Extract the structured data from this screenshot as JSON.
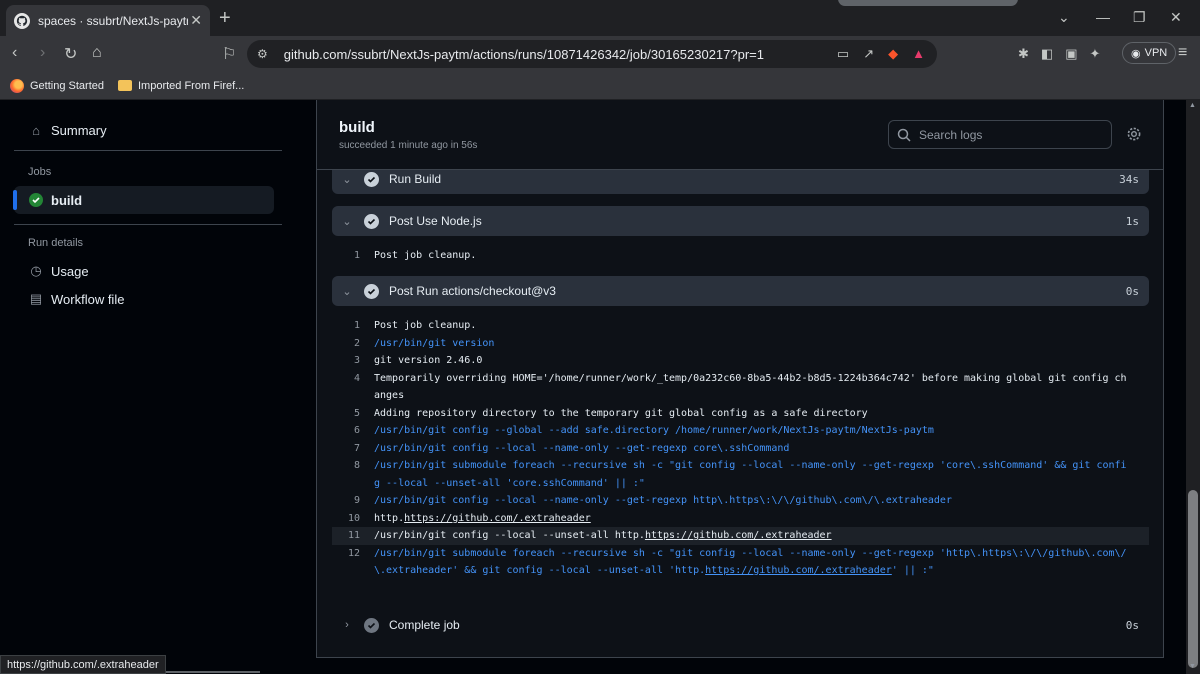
{
  "browser": {
    "tab_title": "spaces · ssubrt/NextJs-paytm@",
    "url": "github.com/ssubrt/NextJs-paytm/actions/runs/10871426342/job/30165230217?pr=1",
    "vpn_label": "VPN",
    "bookmarks": [
      "Getting Started",
      "Imported From Firef..."
    ],
    "status_url": "https://github.com/.extraheader"
  },
  "sidebar": {
    "summary": "Summary",
    "jobs_heading": "Jobs",
    "job": "build",
    "run_details_heading": "Run details",
    "usage": "Usage",
    "workflow_file": "Workflow file"
  },
  "job": {
    "title": "build",
    "subtitle": "succeeded 1 minute ago in 56s",
    "search_placeholder": "Search logs"
  },
  "steps": [
    {
      "name": "Run Build",
      "duration": "34s"
    },
    {
      "name": "Post Use Node.js",
      "duration": "1s"
    },
    {
      "name": "Post Run actions/checkout@v3",
      "duration": "0s"
    },
    {
      "name": "Complete job",
      "duration": "0s"
    }
  ],
  "node_log": [
    {
      "n": "1",
      "text": "Post job cleanup."
    }
  ],
  "checkout_log": [
    {
      "n": "1",
      "text": "Post job cleanup.",
      "cmd": false
    },
    {
      "n": "2",
      "text": "/usr/bin/git version",
      "cmd": true
    },
    {
      "n": "3",
      "text": "git version 2.46.0",
      "cmd": false
    },
    {
      "n": "4",
      "text": "Temporarily overriding HOME='/home/runner/work/_temp/0a232c60-8ba5-44b2-b8d5-1224b364c742' before making global git config changes",
      "cmd": false
    },
    {
      "n": "5",
      "text": "Adding repository directory to the temporary git global config as a safe directory",
      "cmd": false
    },
    {
      "n": "6",
      "text": "/usr/bin/git config --global --add safe.directory /home/runner/work/NextJs-paytm/NextJs-paytm",
      "cmd": true
    },
    {
      "n": "7",
      "text": "/usr/bin/git config --local --name-only --get-regexp core\\.sshCommand",
      "cmd": true
    },
    {
      "n": "8",
      "text": "/usr/bin/git submodule foreach --recursive sh -c \"git config --local --name-only --get-regexp 'core\\.sshCommand' && git config --local --unset-all 'core.sshCommand' || :\"",
      "cmd": true
    },
    {
      "n": "9",
      "text": "/usr/bin/git config --local --name-only --get-regexp http\\.https\\:\\/\\/github\\.com\\/\\.extraheader",
      "cmd": true
    },
    {
      "n": "10",
      "pre": "http.",
      "link": "https://github.com/.extraheader",
      "post": "",
      "cmd": false
    },
    {
      "n": "11",
      "pre": "/usr/bin/git config --local --unset-all http.",
      "link": "https://github.com/.extraheader",
      "post": "",
      "cmd": false,
      "highlight": true
    },
    {
      "n": "12",
      "pre": "/usr/bin/git submodule foreach --recursive sh -c \"git config --local --name-only --get-regexp 'http\\.https\\:\\/\\/github\\.com\\/\\.extraheader' && git config --local --unset-all 'http.",
      "link": "https://github.com/.extraheader",
      "post": "' || :\"",
      "cmd": true
    }
  ]
}
